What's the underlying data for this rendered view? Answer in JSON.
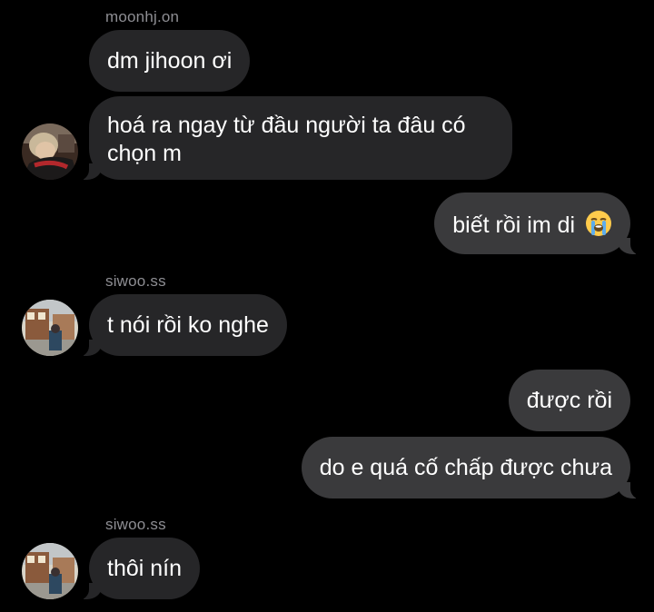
{
  "thread": {
    "messages": [
      {
        "sender": "moonhj.on",
        "side": "in",
        "text": "dm jihoon ơi"
      },
      {
        "sender": "moonhj.on",
        "side": "in",
        "text": "hoá ra ngay từ đầu người ta đâu có chọn m"
      },
      {
        "side": "out",
        "text": "biết rồi im di",
        "emoji": "loudly-crying-face-icon"
      },
      {
        "sender": "siwoo.ss",
        "side": "in",
        "text": "t nói rồi ko nghe"
      },
      {
        "side": "out",
        "text": "được rồi"
      },
      {
        "side": "out",
        "text": "do e quá cố chấp được chưa"
      },
      {
        "sender": "siwoo.ss",
        "side": "in",
        "text": "thôi nín"
      }
    ]
  },
  "colors": {
    "background": "#000000",
    "incoming_bubble": "#262628",
    "outgoing_bubble": "#3a3a3c",
    "sender_name": "#8e8e93",
    "text": "#ffffff"
  }
}
